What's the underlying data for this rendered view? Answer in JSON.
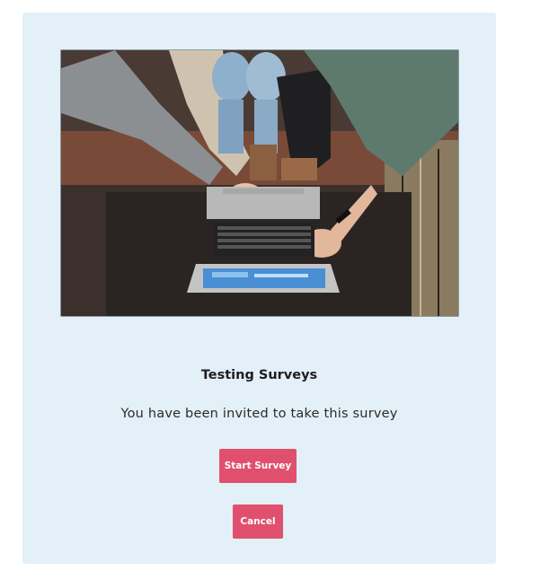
{
  "survey": {
    "title": "Testing Surveys",
    "invitation": "You have been invited to take this survey"
  },
  "actions": {
    "start_label": "Start Survey",
    "cancel_label": "Cancel"
  },
  "hero_image": {
    "subject": "people-pointing-at-laptop"
  },
  "colors": {
    "card_background": "#e3f0f7",
    "button": "#e0506e",
    "button_text": "#ffffff"
  }
}
